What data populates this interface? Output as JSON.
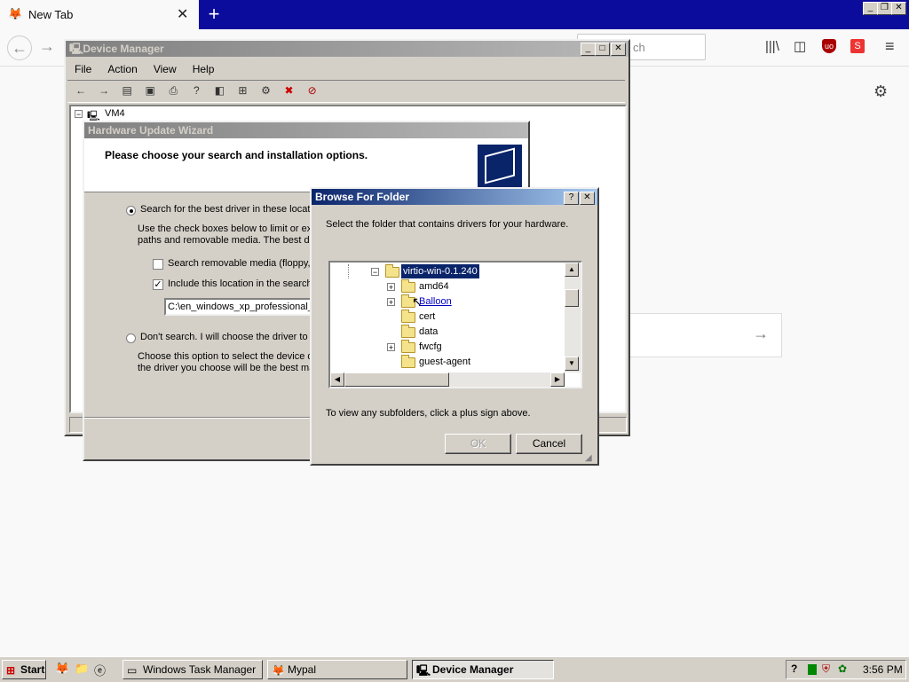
{
  "browser": {
    "tab_title": "New Tab",
    "search_placeholder": "ch",
    "icons": [
      "back-icon",
      "forward-icon",
      "library-icon",
      "sidebar-icon",
      "ublock-icon",
      "addon-icon",
      "menu-icon",
      "gear-icon",
      "arrow-right-icon"
    ]
  },
  "device_manager": {
    "title": "Device Manager",
    "menu": [
      "File",
      "Action",
      "View",
      "Help"
    ],
    "tree_root": "VM4"
  },
  "wizard": {
    "title": "Hardware Update Wizard",
    "heading": "Please choose your search and installation options.",
    "option_search": "Search for the best driver in these locatio",
    "option_search_desc1": "Use the check boxes below to limit or exp",
    "option_search_desc2": "paths and removable media. The best driv",
    "chk_removable": "Search removable media (floppy, C",
    "chk_include": "Include this location in the search:",
    "path_value": "C:\\en_windows_xp_professional_",
    "option_dont": "Don't search. I will choose the driver to in",
    "option_dont_desc1": "Choose this option to select the device dr",
    "option_dont_desc2": "the driver you choose will be the best mat"
  },
  "browse": {
    "title": "Browse For Folder",
    "help_btn": "?",
    "close_btn": "✕",
    "instruction": "Select the folder that contains drivers for your hardware.",
    "tree": [
      {
        "label": "virtio-win-0.1.240",
        "expander": "−",
        "selected": true
      },
      {
        "label": "amd64",
        "expander": "+"
      },
      {
        "label": "Balloon",
        "expander": "+"
      },
      {
        "label": "cert",
        "expander": ""
      },
      {
        "label": "data",
        "expander": ""
      },
      {
        "label": "fwcfg",
        "expander": "+"
      },
      {
        "label": "guest-agent",
        "expander": ""
      }
    ],
    "hint": "To view any subfolders, click a plus sign above.",
    "ok": "OK",
    "cancel": "Cancel"
  },
  "taskbar": {
    "start": "Start",
    "tasks": [
      {
        "label": "Windows Task Manager",
        "active": false
      },
      {
        "label": "Mypal",
        "active": false
      },
      {
        "label": "Device Manager",
        "active": true
      }
    ],
    "help_tray": "?",
    "clock": "3:56 PM"
  }
}
